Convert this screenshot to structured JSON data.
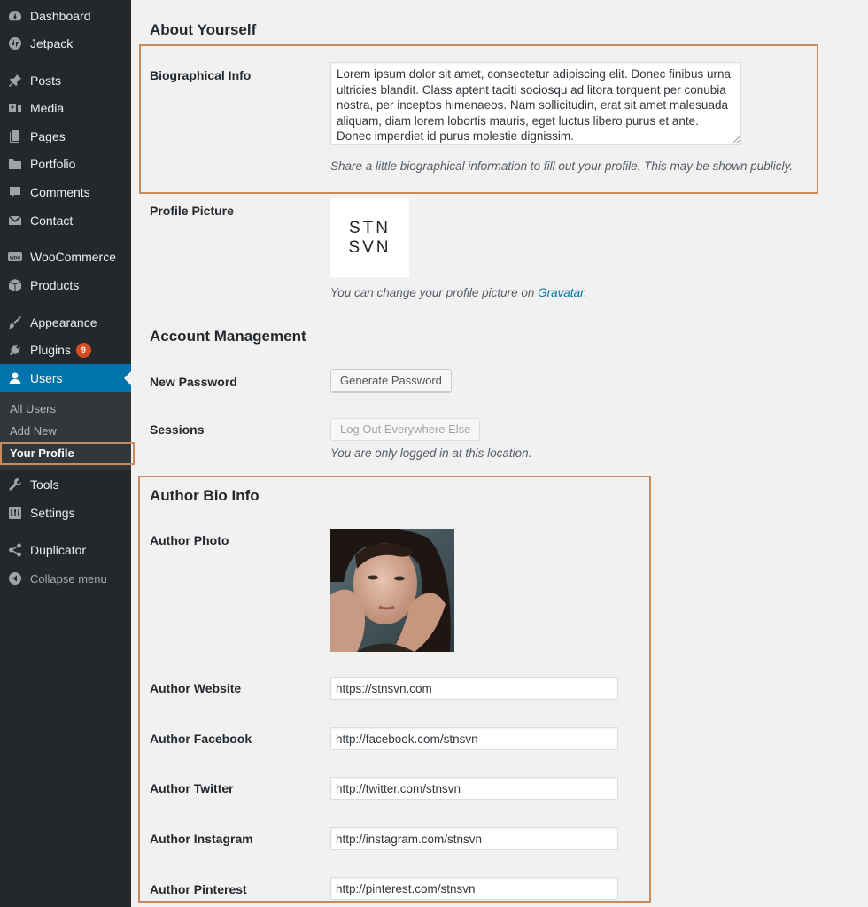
{
  "sidebar": {
    "items": [
      {
        "label": "Dashboard",
        "icon": "dashboard-icon"
      },
      {
        "label": "Jetpack",
        "icon": "jetpack-icon"
      },
      {
        "label": "Posts",
        "icon": "pin-icon"
      },
      {
        "label": "Media",
        "icon": "media-icon"
      },
      {
        "label": "Pages",
        "icon": "pages-icon"
      },
      {
        "label": "Portfolio",
        "icon": "folder-icon"
      },
      {
        "label": "Comments",
        "icon": "comment-icon"
      },
      {
        "label": "Contact",
        "icon": "mail-icon"
      },
      {
        "label": "WooCommerce",
        "icon": "woocommerce-icon"
      },
      {
        "label": "Products",
        "icon": "products-icon"
      },
      {
        "label": "Appearance",
        "icon": "brush-icon"
      },
      {
        "label": "Plugins",
        "icon": "plugin-icon",
        "badge": "9"
      },
      {
        "label": "Users",
        "icon": "user-icon"
      },
      {
        "label": "Tools",
        "icon": "wrench-icon"
      },
      {
        "label": "Settings",
        "icon": "settings-icon"
      },
      {
        "label": "Duplicator",
        "icon": "share-icon"
      }
    ],
    "users_submenu": [
      "All Users",
      "Add New",
      "Your Profile"
    ],
    "collapse_label": "Collapse menu"
  },
  "about": {
    "title": "About Yourself",
    "bio_label": "Biographical Info",
    "bio_text": "Lorem ipsum dolor sit amet, consectetur adipiscing elit. Donec finibus urna ultricies blandit. Class aptent taciti sociosqu ad litora torquent per conubia nostra, per inceptos himenaeos. Nam sollicitudin, erat sit amet malesuada aliquam, diam lorem lobortis mauris, eget luctus libero purus et ante. Donec imperdiet id purus molestie dignissim.",
    "bio_desc": "Share a little biographical information to fill out your profile. This may be shown publicly.",
    "picture_label": "Profile Picture",
    "gravatar_line1": "STN",
    "gravatar_line2": "SVN",
    "picture_desc_prefix": "You can change your profile picture on ",
    "picture_desc_link": "Gravatar",
    "picture_desc_suffix": "."
  },
  "account": {
    "title": "Account Management",
    "password_label": "New Password",
    "generate_button": "Generate Password",
    "sessions_label": "Sessions",
    "logout_button": "Log Out Everywhere Else",
    "sessions_desc": "You are only logged in at this location."
  },
  "author": {
    "title": "Author Bio Info",
    "photo_label": "Author Photo",
    "fields": [
      {
        "label": "Author Website",
        "value": "https://stnsvn.com"
      },
      {
        "label": "Author Facebook",
        "value": "http://facebook.com/stnsvn"
      },
      {
        "label": "Author Twitter",
        "value": "http://twitter.com/stnsvn"
      },
      {
        "label": "Author Instagram",
        "value": "http://instagram.com/stnsvn"
      },
      {
        "label": "Author Pinterest",
        "value": "http://pinterest.com/stnsvn"
      }
    ]
  },
  "colors": {
    "sidebar_bg": "#23282d",
    "active_blue": "#0073aa",
    "highlight_border": "#c98b5e",
    "badge": "#d54e21"
  }
}
